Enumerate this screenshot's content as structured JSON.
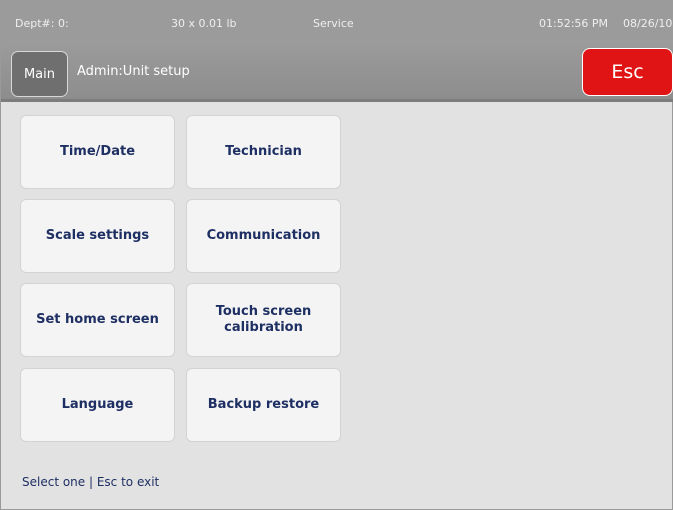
{
  "status_bar": {
    "dept": "Dept#: 0:",
    "weight": "30 x 0.01 lb",
    "mode": "Service",
    "time": "01:52:56 PM",
    "date": "08/26/10"
  },
  "header": {
    "main_label": "Main",
    "title": "Admin:Unit setup",
    "esc_label": "Esc"
  },
  "menu": {
    "time_date": "Time/Date",
    "technician": "Technician",
    "scale_settings": "Scale settings",
    "communication": "Communication",
    "set_home_screen": "Set home screen",
    "touch_screen_calibration": "Touch screen calibration",
    "language": "Language",
    "backup_restore": "Backup restore"
  },
  "footer": {
    "hint": "Select one | Esc to exit"
  },
  "colors": {
    "esc": "#e01414",
    "text": "#1e2f63",
    "header": "#9b9b9b"
  }
}
